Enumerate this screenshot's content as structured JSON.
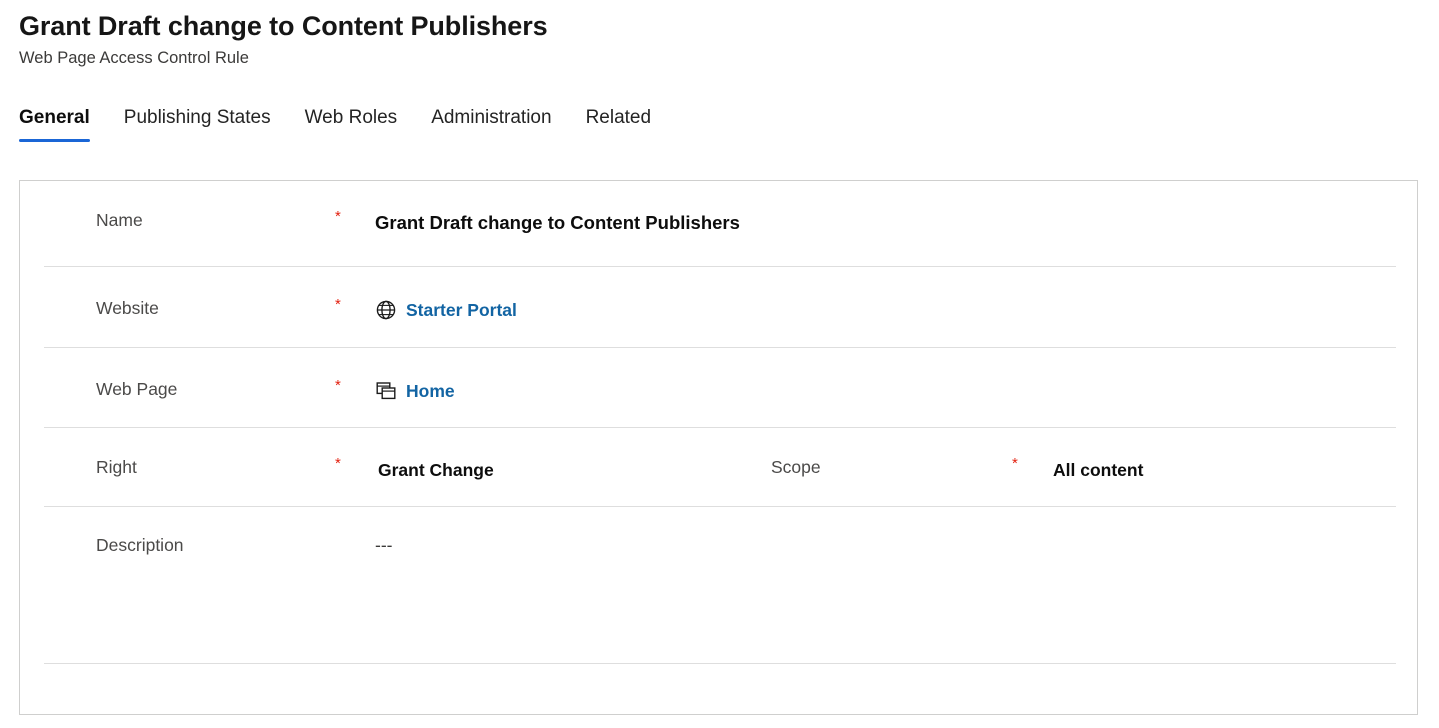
{
  "header": {
    "title": "Grant Draft change to Content Publishers",
    "subtitle": "Web Page Access Control Rule"
  },
  "tabs": [
    {
      "label": "General",
      "active": true
    },
    {
      "label": "Publishing States",
      "active": false
    },
    {
      "label": "Web Roles",
      "active": false
    },
    {
      "label": "Administration",
      "active": false
    },
    {
      "label": "Related",
      "active": false
    }
  ],
  "form": {
    "required_marker": "*",
    "rows": {
      "name": {
        "label": "Name",
        "required": true,
        "value": "Grant Draft change to Content Publishers"
      },
      "website": {
        "label": "Website",
        "required": true,
        "value": "Starter Portal",
        "icon": "globe-icon"
      },
      "webpage": {
        "label": "Web Page",
        "required": true,
        "value": "Home",
        "icon": "web-page-icon"
      },
      "right": {
        "label": "Right",
        "required": true,
        "value": "Grant Change"
      },
      "scope": {
        "label": "Scope",
        "required": true,
        "value": "All content"
      },
      "description": {
        "label": "Description",
        "required": false,
        "value": "---"
      }
    }
  },
  "colors": {
    "link": "#1264a3",
    "accent": "#1a66d6",
    "required": "#e3200f",
    "label": "#4b4a49",
    "value": "#0d0d0d",
    "separator": "#dedede",
    "card_border": "#cfcfce"
  }
}
